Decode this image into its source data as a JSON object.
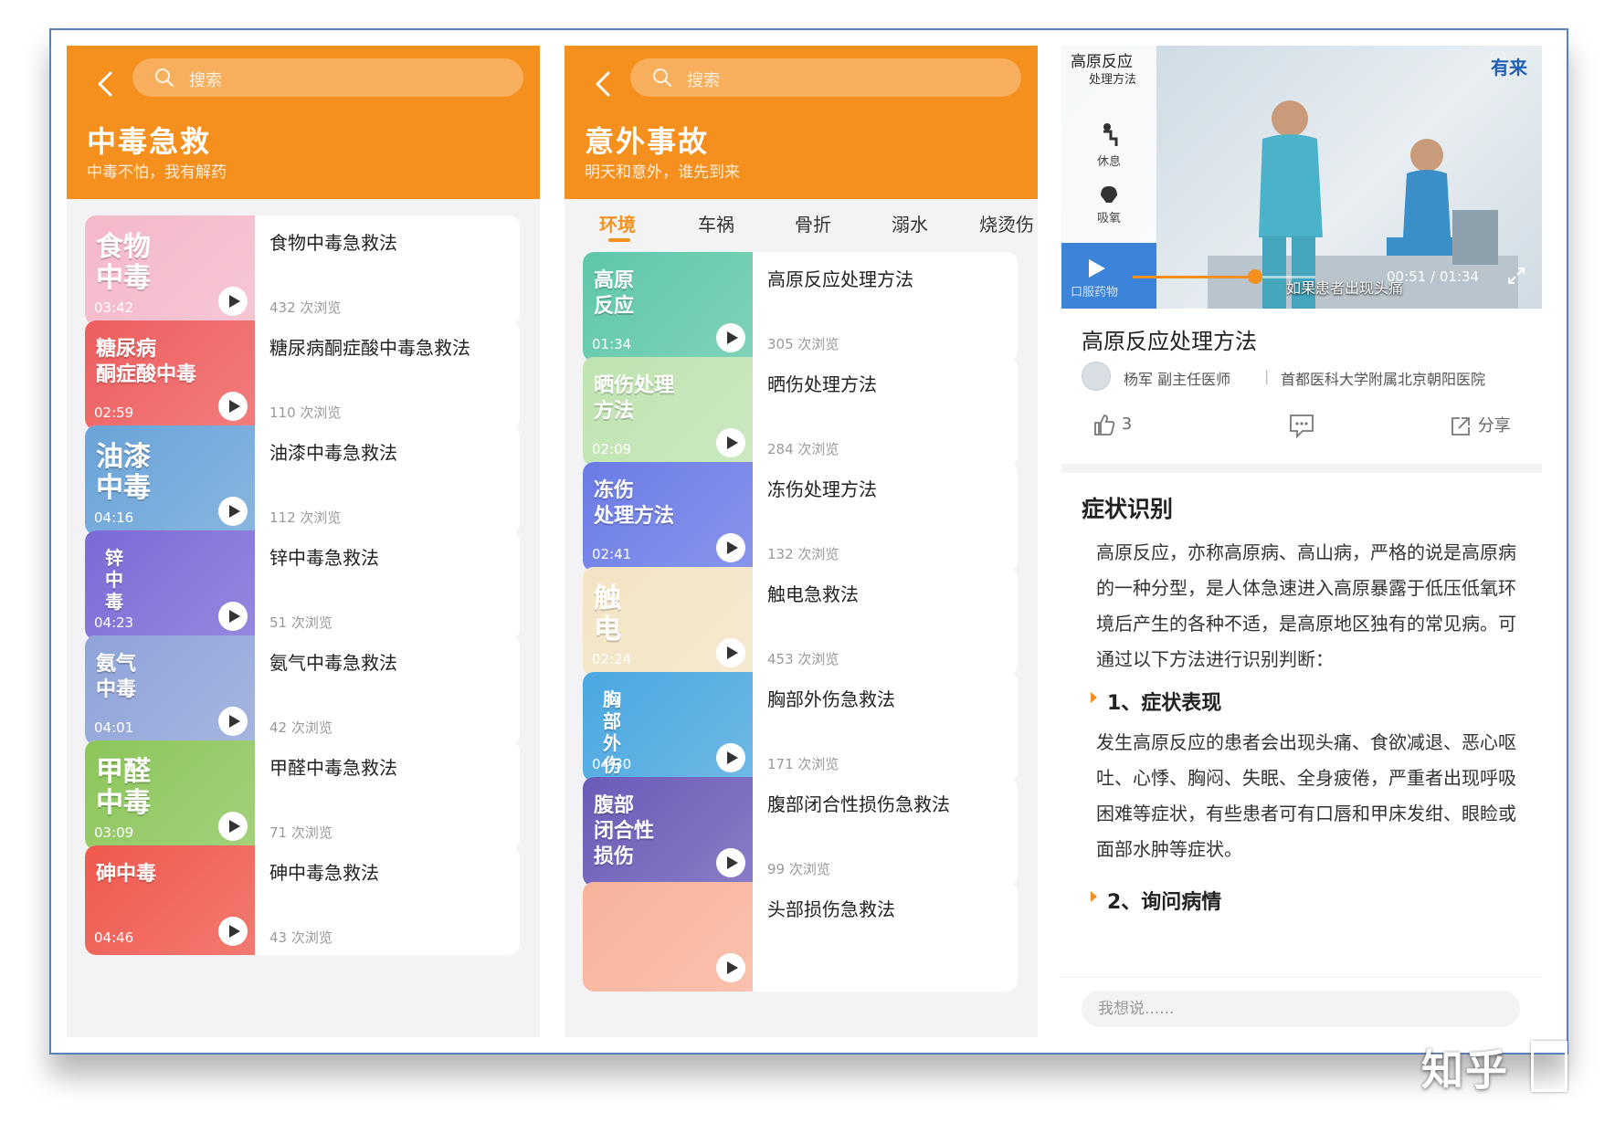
{
  "colors": {
    "accent": "#f5901f",
    "bg": "#f3f3f5",
    "text": "#222222"
  },
  "panel_a": {
    "search_placeholder": "搜索",
    "title": "中毒急救",
    "subtitle": "中毒不怕，我有解药",
    "items": [
      {
        "thumb_text": "食物\n中毒",
        "duration": "03:42",
        "title": "食物中毒急救法",
        "views": "432 次浏览",
        "color": "#f4b8c9"
      },
      {
        "thumb_text": "糖尿病\n酮症酸中毒",
        "duration": "02:59",
        "title": "糖尿病酮症酸中毒急救法",
        "views": "110 次浏览",
        "color": "#ee5d5d"
      },
      {
        "thumb_text": "油漆\n中毒",
        "duration": "04:16",
        "title": "油漆中毒急救法",
        "views": "112 次浏览",
        "color": "#6aa3d8"
      },
      {
        "thumb_text": "锌\n中\n毒",
        "duration": "04:23",
        "title": "锌中毒急救法",
        "views": "51 次浏览",
        "color": "#7b6ad6"
      },
      {
        "thumb_text": "氨气\n中毒",
        "duration": "04:01",
        "title": "氨气中毒急救法",
        "views": "42 次浏览",
        "color": "#8fa3d9"
      },
      {
        "thumb_text": "甲醛\n中毒",
        "duration": "03:09",
        "title": "甲醛中毒急救法",
        "views": "71 次浏览",
        "color": "#8cc65a"
      },
      {
        "thumb_text": "砷中毒",
        "duration": "04:46",
        "title": "砷中毒急救法",
        "views": "43 次浏览",
        "color": "#f0584d"
      }
    ]
  },
  "panel_b": {
    "search_placeholder": "搜索",
    "title": "意外事故",
    "subtitle": "明天和意外，谁先到来",
    "tabs": [
      "环境",
      "车祸",
      "骨折",
      "溺水",
      "烧烫伤"
    ],
    "active_tab": "环境",
    "items": [
      {
        "thumb_text": "高原\n反应",
        "duration": "01:34",
        "title": "高原反应处理方法",
        "views": "305 次浏览",
        "color": "#5fc7a9"
      },
      {
        "thumb_text": "晒伤处理\n方法",
        "duration": "02:09",
        "title": "晒伤处理方法",
        "views": "284 次浏览",
        "color": "#bfe3b0"
      },
      {
        "thumb_text": "冻伤\n处理方法",
        "duration": "02:41",
        "title": "冻伤处理方法",
        "views": "132 次浏览",
        "color": "#6b7be6"
      },
      {
        "thumb_text": "触\n电",
        "duration": "02:24",
        "title": "触电急救法",
        "views": "453 次浏览",
        "color": "#f3e4c4"
      },
      {
        "thumb_text": "胸\n部\n外\n伤",
        "duration": "04:30",
        "title": "胸部外伤急救法",
        "views": "171 次浏览",
        "color": "#4aa7e0"
      },
      {
        "thumb_text": "腹部\n闭合性\n损伤",
        "duration": "",
        "title": "腹部闭合性损伤急救法",
        "views": "99 次浏览",
        "color": "#6b5bb8"
      },
      {
        "thumb_text": "",
        "duration": "",
        "title": "头部损伤急救法",
        "views": "",
        "color": "#f8b29a"
      }
    ]
  },
  "panel_c": {
    "video": {
      "side_title": "高原反应",
      "side_subtitle": "处理方法",
      "side_items": [
        "休息",
        "吸氧",
        "口服药物"
      ],
      "logo": "有来",
      "time": "00:51 / 01:34",
      "subtitle": "如果患者出现头痛",
      "progress": 0.67
    },
    "title": "高原反应处理方法",
    "author_name": "杨军  副主任医师",
    "author_org": "首都医科大学附属北京朝阳医院",
    "likes": "3",
    "share_label": "分享",
    "section_title": "症状识别",
    "intro": "高原反应，亦称高原病、高山病，严格的说是高原病的一种分型，是人体急速进入高原暴露于低压低氧环境后产生的各种不适，是高原地区独有的常见病。可通过以下方法进行识别判断：",
    "sub1": "1、症状表现",
    "sub1_text": "发生高原反应的患者会出现头痛、食欲减退、恶心呕吐、心悸、胸闷、失眠、全身疲倦，严重者出现呼吸困难等症状，有些患者可有口唇和甲床发绀、眼睑或面部水肿等症状。",
    "sub2": "2、询问病情",
    "comment_placeholder": "我想说......"
  },
  "watermark": "知乎"
}
